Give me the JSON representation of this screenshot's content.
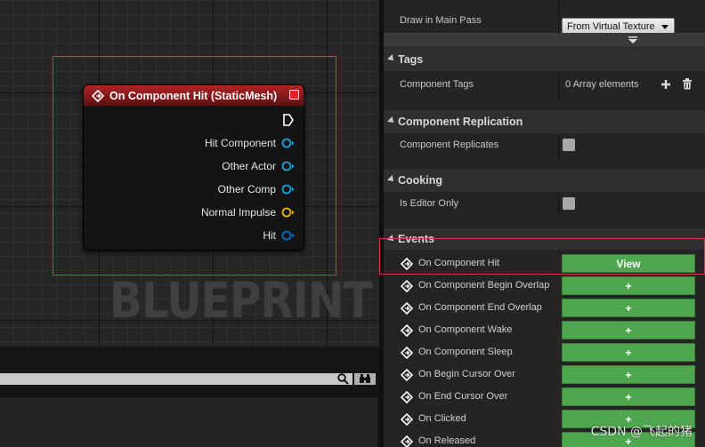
{
  "graph": {
    "node": {
      "title": "On Component Hit (StaticMesh)",
      "pins": [
        {
          "label": "Hit Component",
          "color": "#1aa0e0"
        },
        {
          "label": "Other Actor",
          "color": "#1aa0e0"
        },
        {
          "label": "Other Comp",
          "color": "#1aa0e0"
        },
        {
          "label": "Normal Impulse",
          "color": "#f0b400"
        },
        {
          "label": "Hit",
          "color": "#0a6ec8"
        }
      ]
    },
    "watermark": "BLUEPRINT"
  },
  "details": {
    "draw_in_main_pass": {
      "label": "Draw in Main Pass",
      "value": "From Virtual Texture"
    },
    "tags": {
      "category": "Tags",
      "component_tags_label": "Component Tags",
      "component_tags_value": "0 Array elements"
    },
    "replication": {
      "category": "Component Replication",
      "label": "Component Replicates",
      "checked": false
    },
    "cooking": {
      "category": "Cooking",
      "label": "Is Editor Only",
      "checked": false
    },
    "events": {
      "category": "Events",
      "items": [
        {
          "label": "On Component Hit",
          "button": "View"
        },
        {
          "label": "On Component Begin Overlap",
          "button": "+"
        },
        {
          "label": "On Component End Overlap",
          "button": "+"
        },
        {
          "label": "On Component Wake",
          "button": "+"
        },
        {
          "label": "On Component Sleep",
          "button": "+"
        },
        {
          "label": "On Begin Cursor Over",
          "button": "+"
        },
        {
          "label": "On End Cursor Over",
          "button": "+"
        },
        {
          "label": "On Clicked",
          "button": "+"
        },
        {
          "label": "On Released",
          "button": "+"
        }
      ]
    }
  },
  "watermark_csdn": "CSDN @飞起的猪",
  "colors": {
    "event_button": "#4ea64e",
    "node_header": "#b12424",
    "highlight": "#d23b3b"
  }
}
